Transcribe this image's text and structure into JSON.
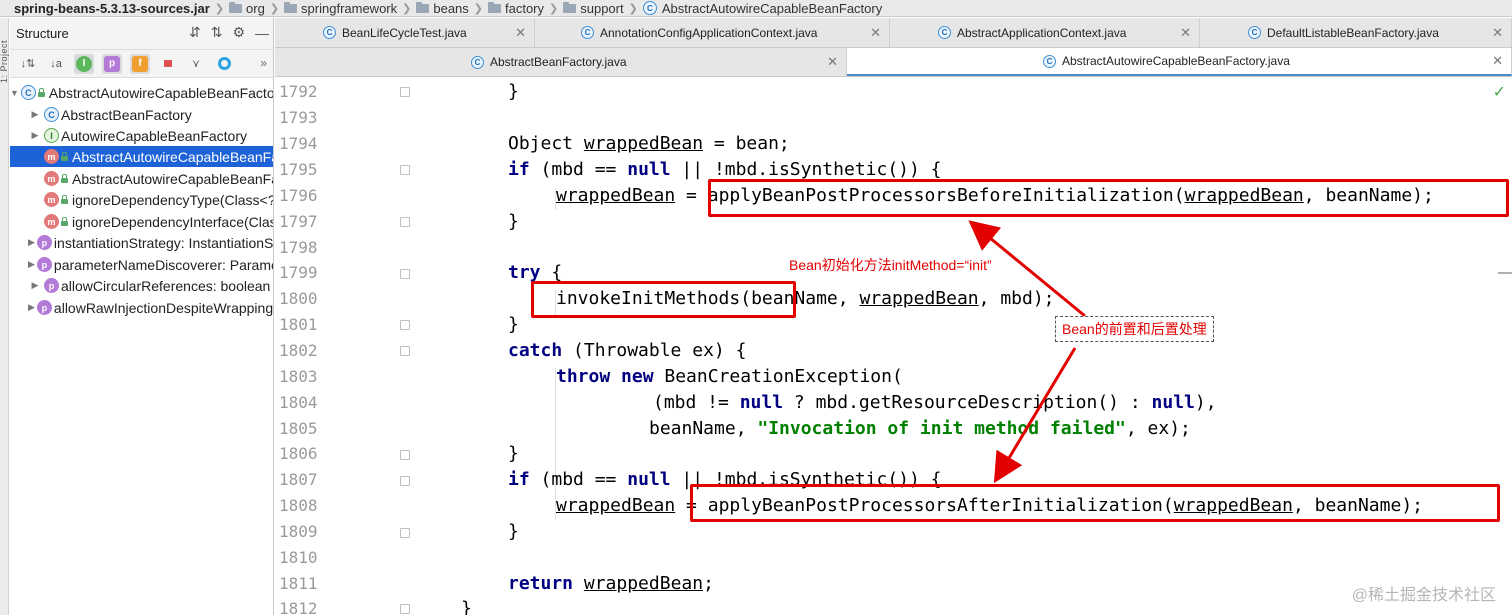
{
  "breadcrumb": {
    "jar": "spring-beans-5.3.13-sources.jar",
    "items": [
      "org",
      "springframework",
      "beans",
      "factory",
      "support"
    ],
    "current": "AbstractAutowireCapableBeanFactory"
  },
  "left_strip": {
    "label": "1: Project"
  },
  "structure": {
    "title": "Structure",
    "tree": [
      {
        "label": "AbstractAutowireCapableBeanFactory",
        "icon": "C"
      },
      {
        "label": "AbstractBeanFactory",
        "icon": "C"
      },
      {
        "label": "AutowireCapableBeanFactory",
        "icon": "I"
      },
      {
        "label": "AbstractAutowireCapableBeanFactory()",
        "icon": "m"
      },
      {
        "label": "AbstractAutowireCapableBeanFactory(BeanFactory)",
        "icon": "m"
      },
      {
        "label": "ignoreDependencyType(Class<?>)",
        "icon": "m"
      },
      {
        "label": "ignoreDependencyInterface(Class<?>)",
        "icon": "m"
      },
      {
        "label": "instantiationStrategy: InstantiationStrategy",
        "icon": "p"
      },
      {
        "label": "parameterNameDiscoverer: ParameterNameDiscoverer",
        "icon": "p"
      },
      {
        "label": "allowCircularReferences: boolean",
        "icon": "p"
      },
      {
        "label": "allowRawInjectionDespiteWrapping: boolean",
        "icon": "p"
      }
    ]
  },
  "tabs_row1": [
    {
      "label": "BeanLifeCycleTest.java"
    },
    {
      "label": "AnnotationConfigApplicationContext.java"
    },
    {
      "label": "AbstractApplicationContext.java"
    },
    {
      "label": "DefaultListableBeanFactory.java"
    }
  ],
  "tabs_row2": [
    {
      "label": "AbstractBeanFactory.java"
    },
    {
      "label": "AbstractAutowireCapableBeanFactory.java"
    }
  ],
  "editor": {
    "line_numbers": [
      "1792",
      "1793",
      "1794",
      "1795",
      "1796",
      "1797",
      "1798",
      "1799",
      "1800",
      "1801",
      "1802",
      "1803",
      "1804",
      "1805",
      "1806",
      "1807",
      "1808",
      "1809",
      "1810",
      "1811",
      "1812"
    ],
    "code": {
      "l1792": "}",
      "l1794_a": "Object ",
      "l1794_b": "wrappedBean",
      "l1794_c": " = bean;",
      "kw_if": "if",
      "mbd_check": " (mbd == ",
      "kw_null": "null",
      "synthetic": " || !mbd.isSynthetic()) {",
      "wrapped_var": "wrappedBean",
      "eq": " = ",
      "apply_before": "applyBeanPostProcessorsBeforeInitialization(",
      "apply_after": "applyBeanPostProcessorsAfterInitialization(",
      "comma_beanname": ", beanName);",
      "close_brace": "}",
      "kw_try": "try",
      "open_brace": " {",
      "invoke": "invokeInitMethods(beanName, ",
      "invoke_tail": ", mbd);",
      "kw_catch": "catch",
      "catch_tail": " (Throwable ex) {",
      "kw_throw": "throw",
      "kw_new": "new",
      "bce": " BeanCreationException(",
      "mbd_ne": "(mbd != ",
      "ternary": " ? mbd.getResourceDescription() : ",
      "close_comma": "),",
      "beanname": "beanName, ",
      "msg": "\"Invocation of init method failed\"",
      "ex_tail": ", ex);",
      "kw_return": "return",
      "return_tail": ";"
    }
  },
  "annotations": {
    "init_note": "Bean初始化方法initMethod=“init”",
    "pre_post_note": "Bean的前置和后置处理"
  },
  "watermark": "@稀土掘金技术社区"
}
